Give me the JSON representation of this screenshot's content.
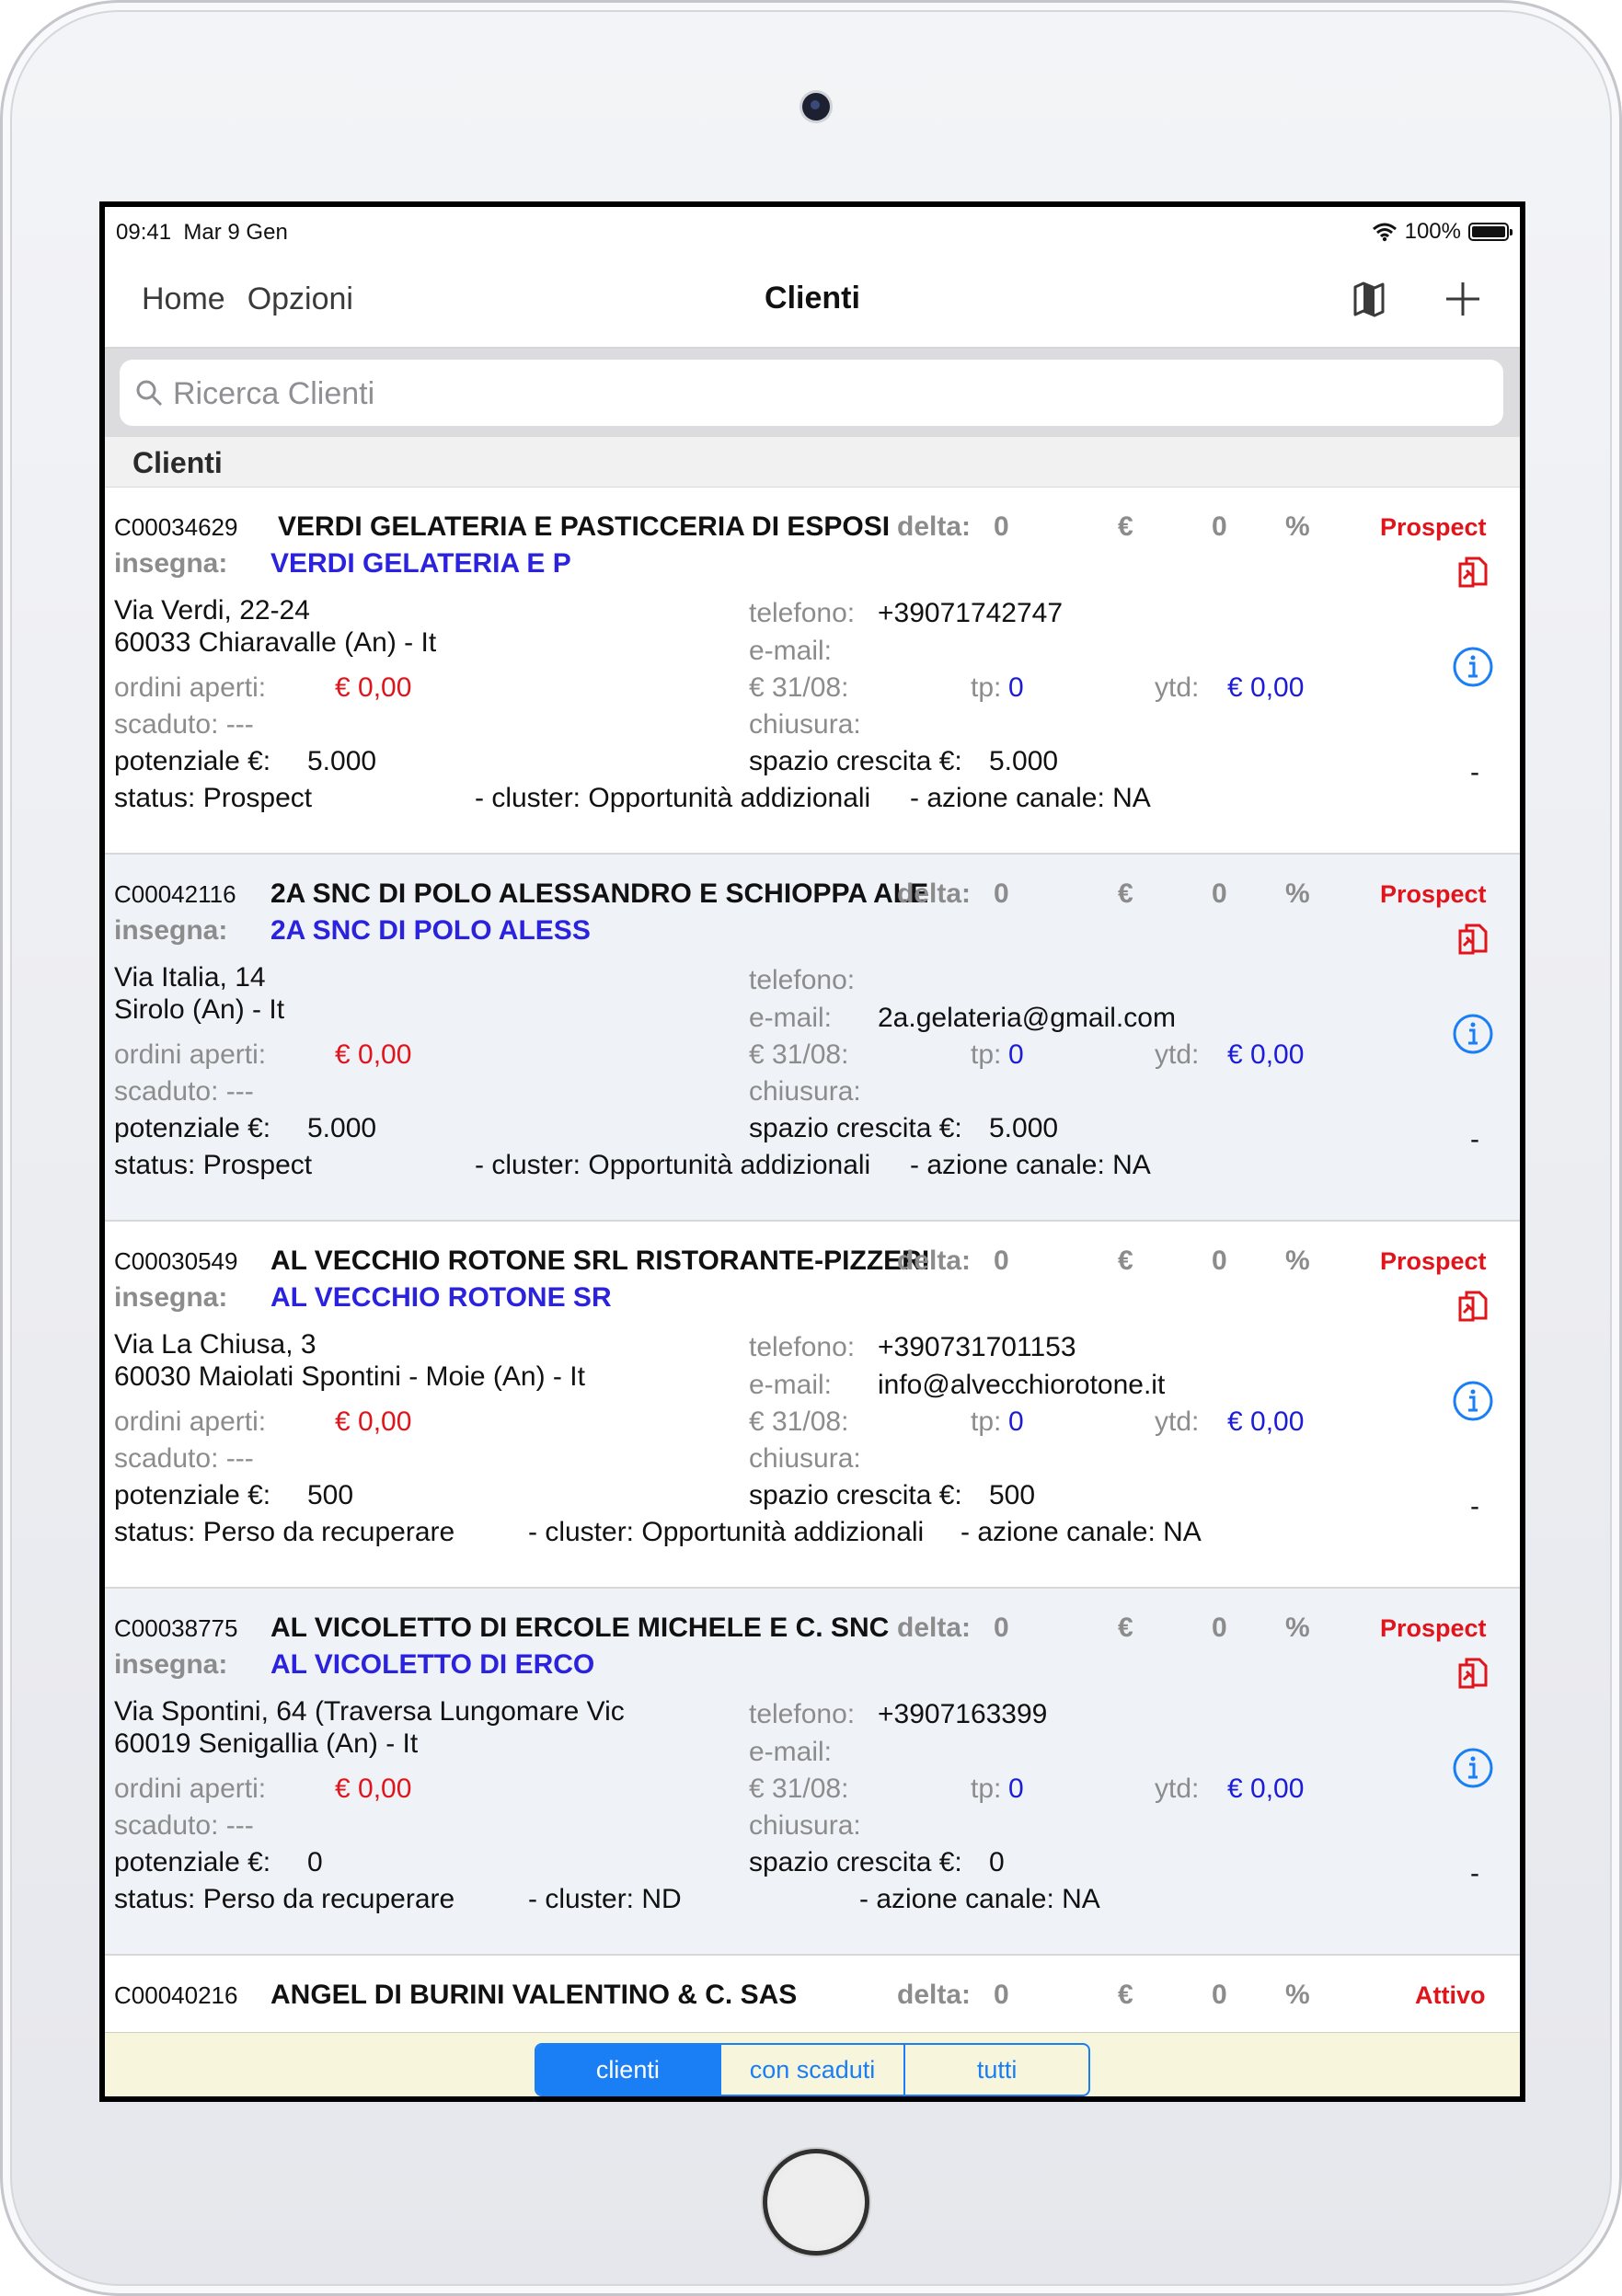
{
  "status_bar": {
    "time": "09:41",
    "date": "Mar 9 Gen",
    "battery": "100%"
  },
  "nav": {
    "home": "Home",
    "options": "Opzioni",
    "title": "Clienti",
    "map_icon": "map-icon",
    "add_icon": "plus-icon"
  },
  "search": {
    "placeholder": "Ricerca Clienti"
  },
  "section": {
    "title": "Clienti"
  },
  "labels": {
    "insegna": "insegna:",
    "delta": "delta:",
    "euro": "€",
    "percent": "%",
    "telefono": "telefono:",
    "email": "e-mail:",
    "ordini": "ordini aperti:",
    "data3108": "€ 31/08:",
    "tp": "tp:",
    "ytd": "ytd:",
    "chiusura": "chiusura:",
    "potenziale": "potenziale €:",
    "spazio": "spazio crescita €:"
  },
  "clients": [
    {
      "code": "C00034629",
      "name": "VERDI GELATERIA E PASTICCERIA DI ESPOSI",
      "delta": "0",
      "pct": "0",
      "type": "Prospect",
      "insegna": "VERDI GELATERIA E P",
      "address1": "Via Verdi, 22-24",
      "address2": "60033 Chiaravalle (An) - It",
      "telefono": "+39071742747",
      "email": "",
      "ordini": "€ 0,00",
      "val3108": "",
      "tp": "0",
      "ytd": "€ 0,00",
      "scaduto": "scaduto: ---",
      "potenziale": "5.000",
      "spazio": "5.000",
      "status": "status: Prospect",
      "cluster": "- cluster: Opportunità addizionali",
      "azione": "- azione canale: NA",
      "dash": "-"
    },
    {
      "code": "C00042116",
      "name": "2A SNC DI POLO ALESSANDRO E SCHIOPPA ALE",
      "delta": "0",
      "pct": "0",
      "type": "Prospect",
      "insegna": "2A SNC DI POLO ALESS",
      "address1": "Via Italia, 14",
      "address2": "Sirolo (An) - It",
      "telefono": "",
      "email": "2a.gelateria@gmail.com",
      "ordini": "€ 0,00",
      "val3108": "",
      "tp": "0",
      "ytd": "€ 0,00",
      "scaduto": "scaduto: ---",
      "potenziale": "5.000",
      "spazio": "5.000",
      "status": "status: Prospect",
      "cluster": "- cluster: Opportunità addizionali",
      "azione": "- azione canale: NA",
      "dash": "-"
    },
    {
      "code": "C00030549",
      "name": "AL VECCHIO ROTONE SRL RISTORANTE-PIZZERI",
      "delta": "0",
      "pct": "0",
      "type": "Prospect",
      "insegna": "AL VECCHIO ROTONE SR",
      "address1": "Via La Chiusa, 3",
      "address2": "60030 Maiolati Spontini - Moie (An) - It",
      "telefono": "+390731701153",
      "email": "info@alvecchiorotone.it",
      "ordini": "€ 0,00",
      "val3108": "",
      "tp": "0",
      "ytd": "€ 0,00",
      "scaduto": "scaduto: ---",
      "potenziale": "500",
      "spazio": "500",
      "status": "status: Perso da recuperare",
      "cluster": "- cluster: Opportunità addizionali",
      "azione": "- azione canale: NA",
      "dash": "-"
    },
    {
      "code": "C00038775",
      "name": "AL VICOLETTO DI ERCOLE MICHELE E C. SNC",
      "delta": "0",
      "pct": "0",
      "type": "Prospect",
      "insegna": "AL VICOLETTO DI ERCO",
      "address1": "Via Spontini, 64 (Traversa Lungomare Vic",
      "address2": "60019 Senigallia (An) - It",
      "telefono": "+3907163399",
      "email": "",
      "ordini": "€ 0,00",
      "val3108": "",
      "tp": "0",
      "ytd": "€ 0,00",
      "scaduto": "scaduto: ---",
      "potenziale": "0",
      "spazio": "0",
      "status": "status: Perso da recuperare",
      "cluster": "- cluster: ND",
      "azione": "- azione canale: NA",
      "dash": "-"
    },
    {
      "code": "C00040216",
      "name": "ANGEL DI BURINI VALENTINO & C. SAS",
      "delta": "0",
      "pct": "0",
      "type": "Attivo"
    }
  ],
  "segments": [
    "clienti",
    "con scaduti",
    "tutti"
  ],
  "colors": {
    "accent": "#1a7ef5",
    "red": "#e0151b",
    "blue": "#2a22dd",
    "alt_row": "#eff2f7",
    "bottom_bar": "#f7f6dc"
  }
}
